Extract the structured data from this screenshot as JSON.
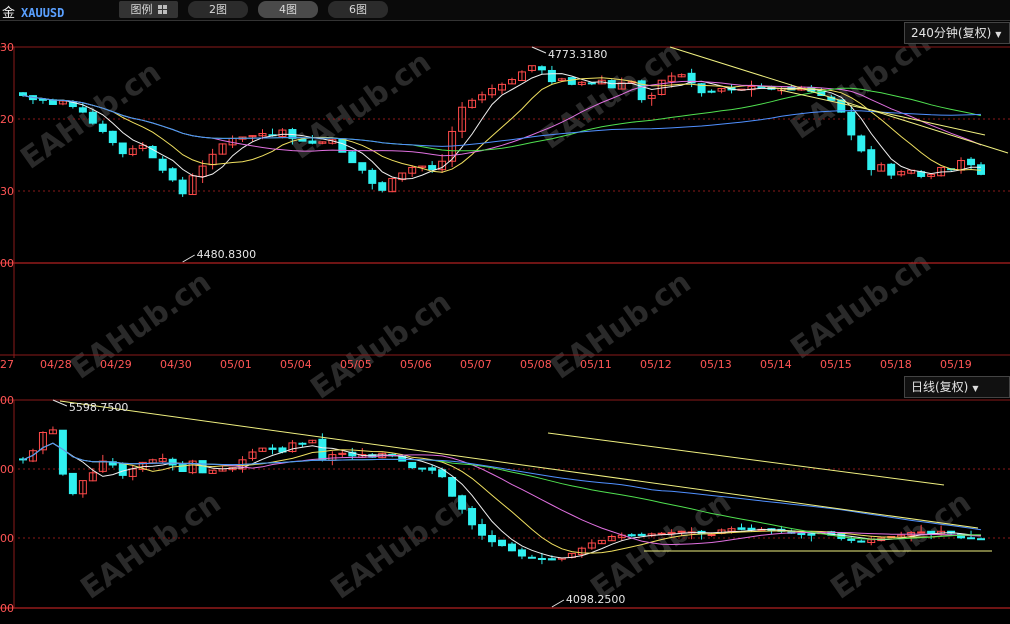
{
  "toolbar": {
    "symbol_name": "金",
    "symbol_code": "XAUUSD",
    "legend_label": "图例",
    "layout_2": "2图",
    "layout_4": "4图",
    "layout_6": "6图"
  },
  "watermark": "EAHub.cn",
  "colors": {
    "up": "#ff4a4a",
    "down": "#30f0f0",
    "grid": "#8a1a1a",
    "axis_text": "#ff5555",
    "trend": "#f0f080"
  },
  "chart_data": [
    {
      "type": "candlestick",
      "period": "240分钟(复权)",
      "y_ticks": [
        "30",
        "20",
        "30",
        "00"
      ],
      "x_labels": [
        "27",
        "04/28",
        "04/29",
        "04/30",
        "05/01",
        "05/04",
        "05/05",
        "05/06",
        "05/07",
        "05/08",
        "05/11",
        "05/12",
        "05/13",
        "05/14",
        "05/15",
        "05/18",
        "05/19"
      ],
      "high_label": "4773.3180",
      "low_label": "4480.8300",
      "ylim": [
        4470,
        4782
      ],
      "closes": [
        4712,
        4706,
        4705,
        4699,
        4704,
        4696,
        4688,
        4672,
        4660,
        4644,
        4628,
        4635,
        4640,
        4622,
        4604,
        4590,
        4570,
        4596,
        4610,
        4627,
        4642,
        4650,
        4652,
        4654,
        4657,
        4655,
        4662,
        4650,
        4646,
        4643,
        4645,
        4648,
        4630,
        4615,
        4604,
        4585,
        4575,
        4592,
        4600,
        4608,
        4610,
        4605,
        4617,
        4660,
        4695,
        4705,
        4713,
        4722,
        4728,
        4735,
        4746,
        4755,
        4749,
        4732,
        4736,
        4728,
        4731,
        4729,
        4734,
        4723,
        4730,
        4732,
        4706,
        4712,
        4734,
        4740,
        4742,
        4730,
        4716,
        4718,
        4722,
        4720,
        4721,
        4725,
        4723,
        4721,
        4722,
        4720,
        4724,
        4718,
        4712,
        4705,
        4688,
        4655,
        4632,
        4605,
        4612,
        4597,
        4602,
        4604,
        4595,
        4598,
        4608,
        4605,
        4618,
        4612,
        4598
      ]
    },
    {
      "type": "candlestick",
      "period": "日线(复权)",
      "y_ticks": [
        "00",
        "00",
        "00",
        "00"
      ],
      "high_label": "5598.7500",
      "low_label": "4098.2500",
      "ylim": [
        4040,
        5640
      ],
      "closes": [
        5180,
        5250,
        5390,
        5410,
        5070,
        4920,
        5020,
        5080,
        5170,
        5140,
        5060,
        5110,
        5160,
        5180,
        5190,
        5140,
        5090,
        5170,
        5080,
        5100,
        5110,
        5120,
        5180,
        5240,
        5270,
        5260,
        5240,
        5310,
        5300,
        5330,
        5180,
        5220,
        5230,
        5210,
        5220,
        5200,
        5230,
        5210,
        5170,
        5120,
        5110,
        5100,
        5050,
        4900,
        4800,
        4680,
        4600,
        4550,
        4520,
        4480,
        4440,
        4430,
        4420,
        4410,
        4425,
        4460,
        4500,
        4540,
        4560,
        4590,
        4600,
        4595,
        4598,
        4610,
        4615,
        4620,
        4630,
        4625,
        4610,
        4605,
        4640,
        4650,
        4645,
        4640,
        4645,
        4635,
        4630,
        4615,
        4605,
        4600,
        4620,
        4600,
        4575,
        4560,
        4550,
        4565,
        4578,
        4590,
        4600,
        4620,
        4625,
        4610,
        4630,
        4615,
        4580,
        4575,
        4570
      ]
    }
  ]
}
